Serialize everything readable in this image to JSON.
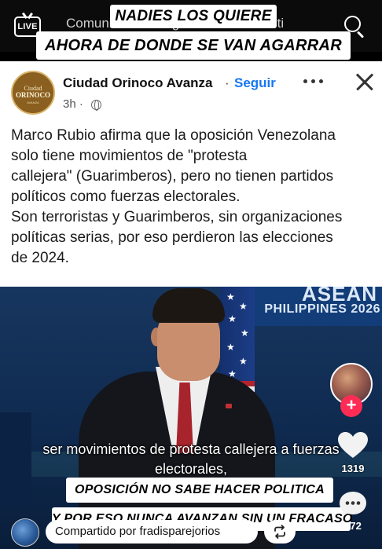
{
  "topnav": {
    "live_label": "LIVE",
    "tabs": [
      "Comunidad",
      "Siguiendo",
      "Para ti"
    ]
  },
  "captions": {
    "top1": "NADIES LOS QUIERE",
    "top2": "AHORA DE DONDE SE VAN AGARRAR",
    "bottom1": "OPOSICIÓN NO SABE HACER POLITICA",
    "bottom2": "Y POR ESO NUNCA AVANZAN SIN UN FRACASO"
  },
  "post": {
    "page_name": "Ciudad Orinoco Avanza",
    "separator": "·",
    "follow_label": "Seguir",
    "timestamp": "3h ·",
    "avatar_text": {
      "line1": "Ciudad",
      "line2": "ORINOCO",
      "line3": "AVANZA"
    },
    "text_lines": [
      "Marco Rubio afirma que la oposición Venezolana",
      "solo tiene movimientos de \"protesta",
      "callejera\" (Guarimberos), pero no tienen partidos",
      "políticos como fuerzas electorales.",
      "Son terroristas y Guarimberos, sin organizaciones",
      "políticas serias, por eso perdieron las elecciones",
      "de 2024."
    ]
  },
  "video": {
    "backdrop_line1": "ASEAN",
    "backdrop_line2": "PHILIPPINES 2026",
    "subtitle_line1": "ser movimientos de protesta callejera a fuerzas",
    "subtitle_line2": "electorales,"
  },
  "actions": {
    "like_count": "1319",
    "comment_count": "272"
  },
  "shared": {
    "label": "Compartido por fradisparejorios"
  },
  "colors": {
    "follow_link": "#1877f2",
    "follow_plus": "#fe2c55",
    "background": "#000000"
  }
}
